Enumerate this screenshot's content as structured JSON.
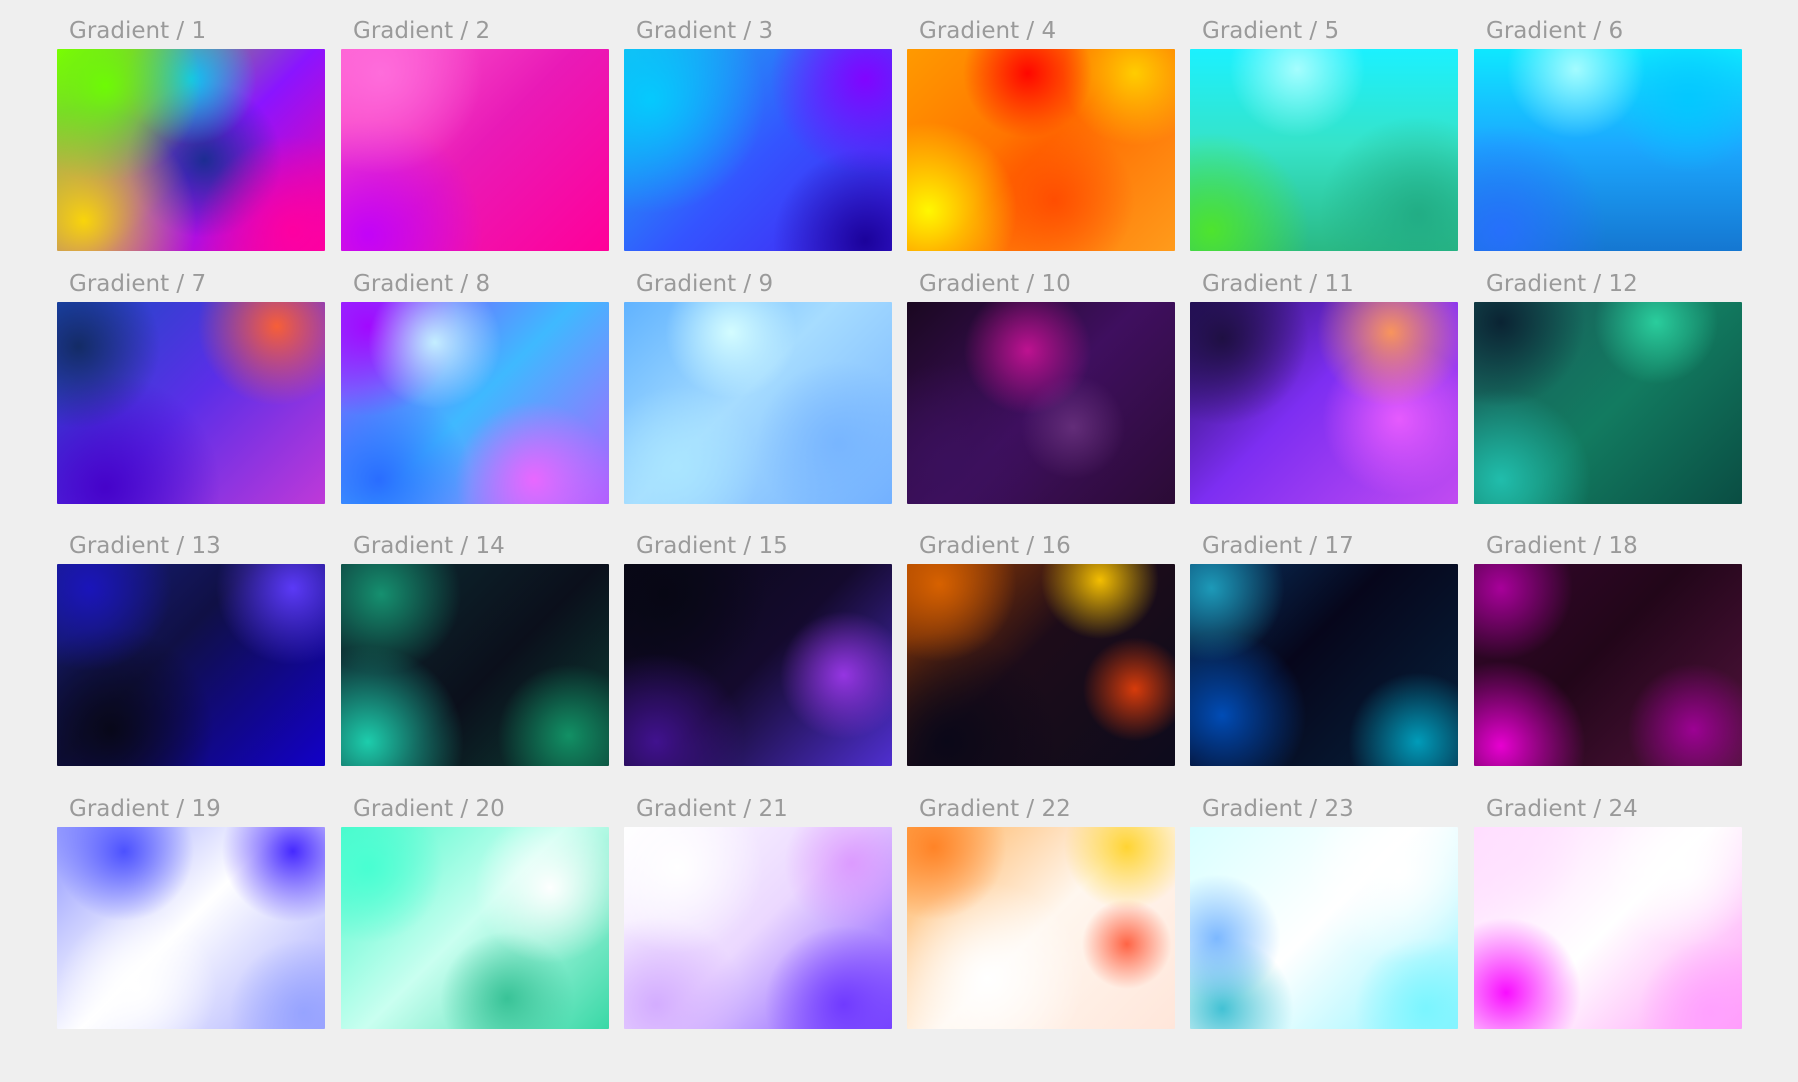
{
  "gallery": {
    "items": [
      {
        "label": "Gradient / 1"
      },
      {
        "label": "Gradient / 2"
      },
      {
        "label": "Gradient / 3"
      },
      {
        "label": "Gradient / 4"
      },
      {
        "label": "Gradient / 5"
      },
      {
        "label": "Gradient / 6"
      },
      {
        "label": "Gradient / 7"
      },
      {
        "label": "Gradient / 8"
      },
      {
        "label": "Gradient / 9"
      },
      {
        "label": "Gradient / 10"
      },
      {
        "label": "Gradient / 11"
      },
      {
        "label": "Gradient / 12"
      },
      {
        "label": "Gradient / 13"
      },
      {
        "label": "Gradient / 14"
      },
      {
        "label": "Gradient / 15"
      },
      {
        "label": "Gradient / 16"
      },
      {
        "label": "Gradient / 17"
      },
      {
        "label": "Gradient / 18"
      },
      {
        "label": "Gradient / 19"
      },
      {
        "label": "Gradient / 20"
      },
      {
        "label": "Gradient / 21"
      },
      {
        "label": "Gradient / 22"
      },
      {
        "label": "Gradient / 23"
      },
      {
        "label": "Gradient / 24"
      }
    ]
  }
}
